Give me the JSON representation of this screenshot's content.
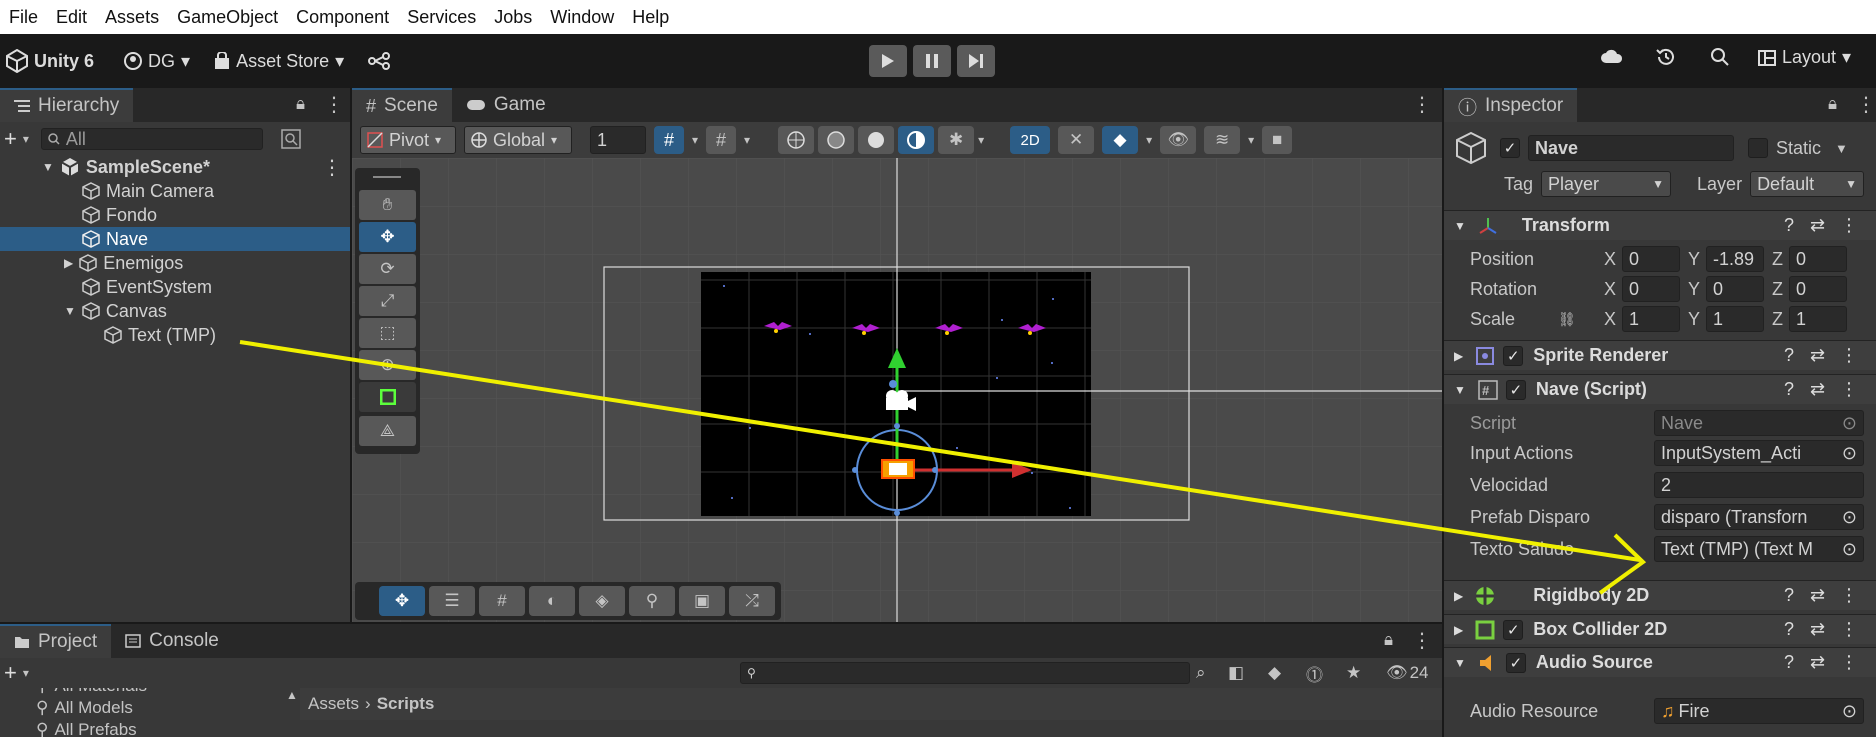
{
  "menu": [
    "File",
    "Edit",
    "Assets",
    "GameObject",
    "Component",
    "Services",
    "Jobs",
    "Window",
    "Help"
  ],
  "toolbar": {
    "app_name": "Unity 6",
    "account": "DG",
    "asset_store": "Asset Store",
    "layout": "Layout"
  },
  "hierarchy": {
    "tab": "Hierarchy",
    "search_placeholder": "All",
    "items": [
      {
        "label": "SampleScene*",
        "level": 0,
        "type": "scene",
        "expanded": true
      },
      {
        "label": "Main Camera",
        "level": 1
      },
      {
        "label": "Fondo",
        "level": 1
      },
      {
        "label": "Nave",
        "level": 1,
        "selected": true
      },
      {
        "label": "Enemigos",
        "level": 1,
        "collapsed": true
      },
      {
        "label": "EventSystem",
        "level": 1
      },
      {
        "label": "Canvas",
        "level": 1,
        "expanded": true
      },
      {
        "label": "Text (TMP)",
        "level": 2
      }
    ]
  },
  "scene": {
    "tabs": [
      "Scene",
      "Game"
    ],
    "pivot": "Pivot",
    "global": "Global",
    "grid_value": "1",
    "mode_2d": "2D"
  },
  "inspector": {
    "tab": "Inspector",
    "object_name": "Nave",
    "static_label": "Static",
    "tag_label": "Tag",
    "tag_value": "Player",
    "layer_label": "Layer",
    "layer_value": "Default",
    "transform": {
      "title": "Transform",
      "position": {
        "label": "Position",
        "x": "0",
        "y": "-1.89",
        "z": "0"
      },
      "rotation": {
        "label": "Rotation",
        "x": "0",
        "y": "0",
        "z": "0"
      },
      "scale": {
        "label": "Scale",
        "x": "1",
        "y": "1",
        "z": "1"
      }
    },
    "sprite_renderer": "Sprite Renderer",
    "script_component": {
      "title": "Nave (Script)",
      "fields": [
        {
          "label": "Script",
          "value": "Nave"
        },
        {
          "label": "Input Actions",
          "value": "InputSystem_Acti"
        },
        {
          "label": "Velocidad",
          "value": "2"
        },
        {
          "label": "Prefab Disparo",
          "value": "disparo (Transforn"
        },
        {
          "label": "Texto Saludo",
          "value": "Text (TMP) (Text M"
        }
      ]
    },
    "rigidbody": "Rigidbody 2D",
    "box_collider": "Box Collider 2D",
    "audio_source": "Audio Source",
    "audio_resource": {
      "label": "Audio Resource",
      "value": "Fire"
    }
  },
  "project": {
    "tabs": [
      "Project",
      "Console"
    ],
    "tree": [
      "All Materials",
      "All Models",
      "All Prefabs"
    ],
    "breadcrumb": [
      "Assets",
      "Scripts"
    ],
    "hidden_count": "24"
  },
  "colors": {
    "selection": "#2c5d87",
    "annotation_arrow": "#f0f000",
    "panel": "#383838"
  }
}
